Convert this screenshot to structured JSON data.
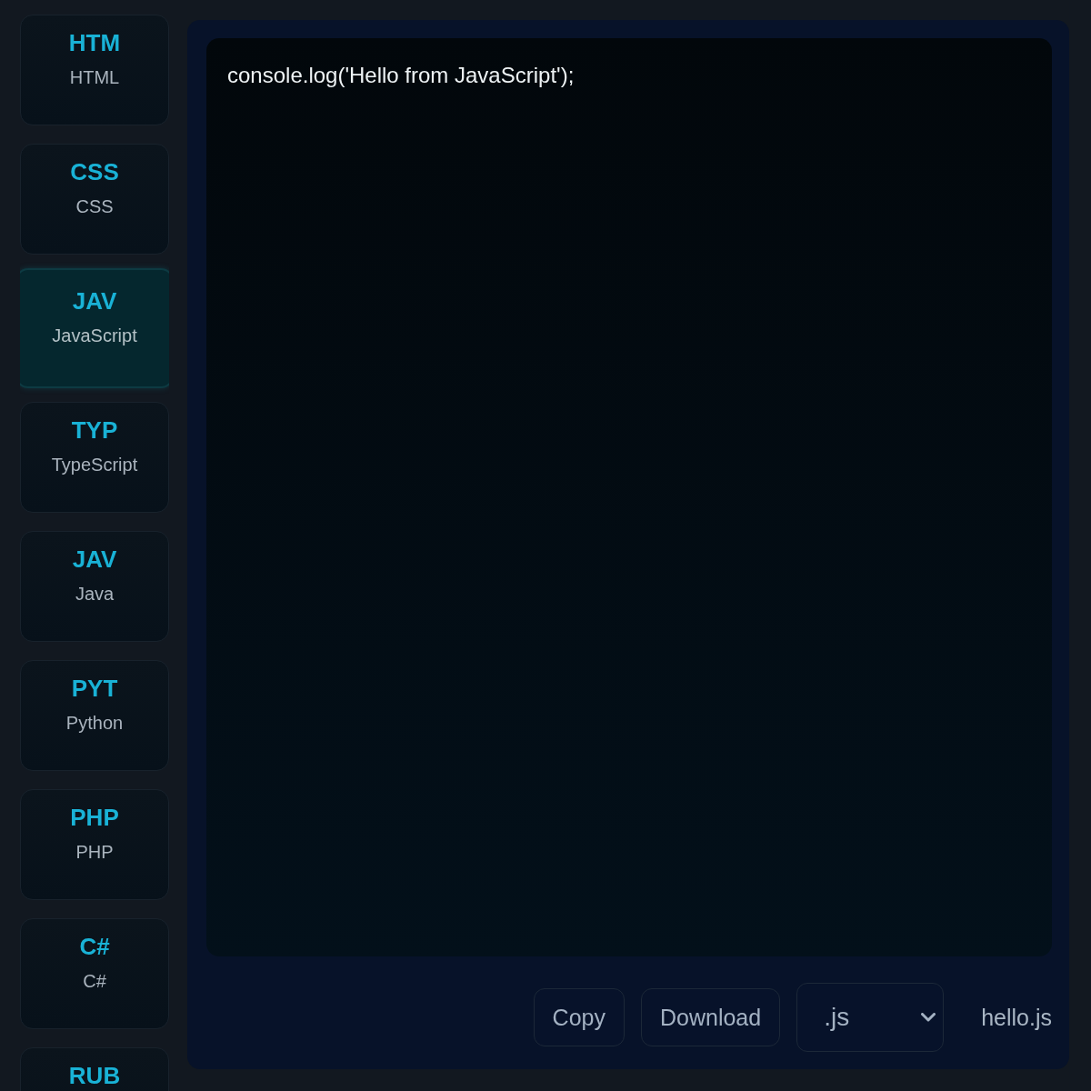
{
  "languages": [
    {
      "abbr": "HTM",
      "name": "HTML",
      "selected": false
    },
    {
      "abbr": "CSS",
      "name": "CSS",
      "selected": false
    },
    {
      "abbr": "JAV",
      "name": "JavaScript",
      "selected": true
    },
    {
      "abbr": "TYP",
      "name": "TypeScript",
      "selected": false
    },
    {
      "abbr": "JAV",
      "name": "Java",
      "selected": false
    },
    {
      "abbr": "PYT",
      "name": "Python",
      "selected": false
    },
    {
      "abbr": "PHP",
      "name": "PHP",
      "selected": false
    },
    {
      "abbr": "C#",
      "name": "C#",
      "selected": false
    },
    {
      "abbr": "RUB",
      "selected": false
    }
  ],
  "editor": {
    "code": "console.log('Hello from JavaScript');"
  },
  "actions": [
    {
      "label": "Copy"
    },
    {
      "label": "Download"
    }
  ],
  "extension_select": {
    "value": ".js"
  },
  "filename": "hello.js"
}
